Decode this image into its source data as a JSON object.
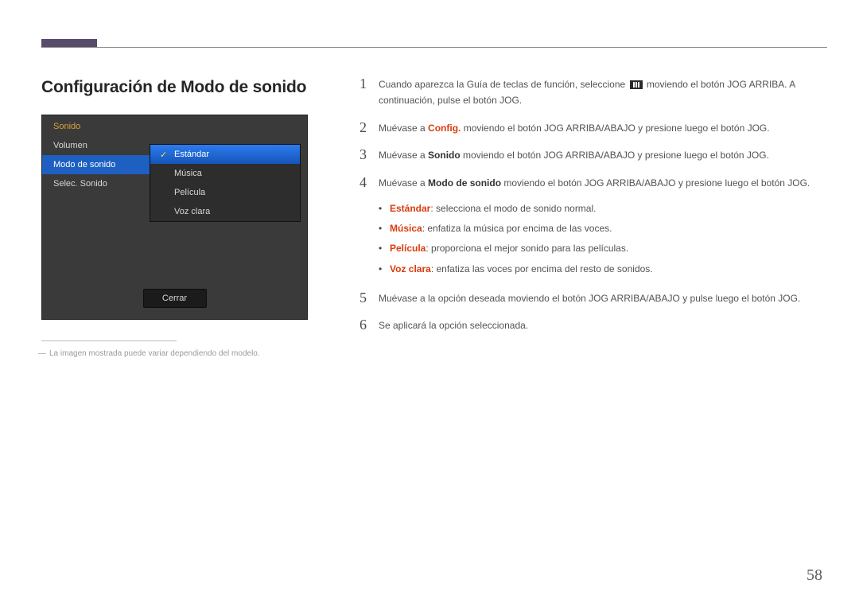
{
  "page": {
    "title": "Configuración de Modo de sonido",
    "number": "58"
  },
  "osd": {
    "tab": "Sonido",
    "menu": [
      "Volumen",
      "Modo de sonido",
      "Selec. Sonido"
    ],
    "submenu": [
      "Estándar",
      "Música",
      "Película",
      "Voz clara"
    ],
    "close": "Cerrar"
  },
  "footnote": "La imagen mostrada puede variar dependiendo del modelo.",
  "steps": {
    "s1a": "Cuando aparezca la Guía de teclas de función, seleccione ",
    "s1b": " moviendo el botón JOG ARRIBA. A continuación, pulse el botón JOG.",
    "s2a": "Muévase a ",
    "s2b": " moviendo el botón JOG ARRIBA/ABAJO y presione luego el botón JOG.",
    "s2h": "Config.",
    "s3a": "Muévase a ",
    "s3b": " moviendo el botón JOG ARRIBA/ABAJO y presione luego el botón JOG.",
    "s3h": "Sonido",
    "s4a": "Muévase a ",
    "s4b": " moviendo el botón JOG ARRIBA/ABAJO y presione luego el botón JOG.",
    "s4h": "Modo de sonido",
    "s5": "Muévase a la opción deseada moviendo el botón JOG ARRIBA/ABAJO y pulse luego el botón JOG.",
    "s6": "Se aplicará la opción seleccionada."
  },
  "bullets": {
    "b1h": "Estándar",
    "b1t": ": selecciona el modo de sonido normal.",
    "b2h": "Música",
    "b2t": ": enfatiza la música por encima de las voces.",
    "b3h": "Película",
    "b3t": ": proporciona el mejor sonido para las películas.",
    "b4h": "Voz clara",
    "b4t": ": enfatiza las voces por encima del resto de sonidos."
  }
}
